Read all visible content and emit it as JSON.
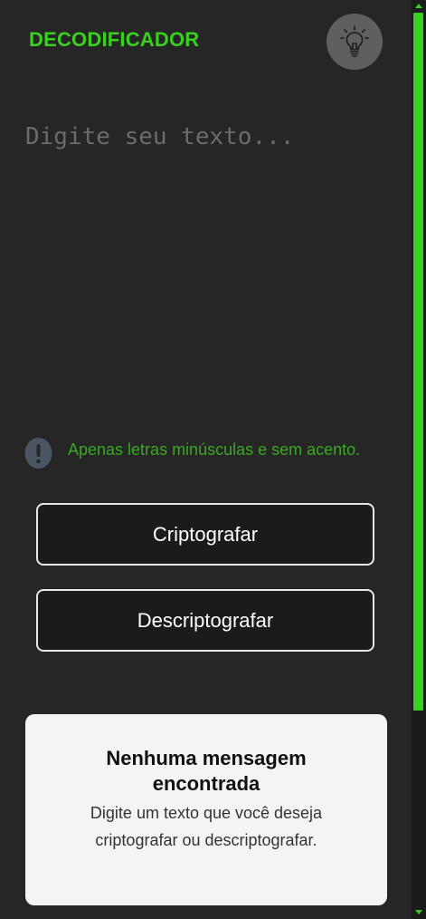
{
  "header": {
    "logo_text": "DECODIFICADOR",
    "theme_toggle_icon": "lightbulb-icon"
  },
  "input": {
    "placeholder": "Digite seu texto...",
    "value": ""
  },
  "info": {
    "icon": "exclamation-icon",
    "text": "Apenas letras minúsculas e sem acento."
  },
  "actions": {
    "encrypt_label": "Criptografar",
    "decrypt_label": "Descriptografar"
  },
  "output": {
    "title": "Nenhuma mensagem encontrada",
    "subtitle": "Digite um texto que você deseja criptografar ou descriptografar."
  },
  "colors": {
    "accent": "#3ad01f",
    "background": "#262626",
    "button_bg": "#1b1b1b",
    "card_bg": "#f4f4f4"
  }
}
